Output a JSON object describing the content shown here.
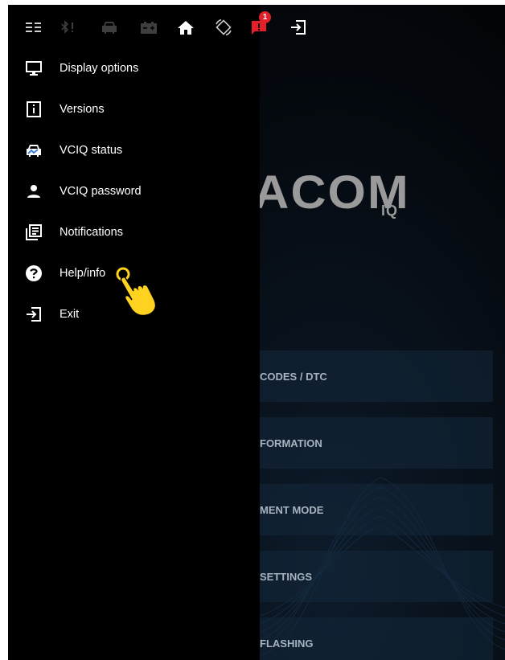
{
  "topbar": {
    "icons": [
      "menu-icon",
      "bluetooth-icon",
      "car-icon",
      "battery-icon",
      "home-icon",
      "rotate-icon",
      "notification-icon",
      "exit-icon"
    ],
    "notification_count": "1"
  },
  "drawer": {
    "items": [
      {
        "label": "Display options",
        "icon": "monitor-icon"
      },
      {
        "label": "Versions",
        "icon": "info-icon"
      },
      {
        "label": "VCIQ status",
        "icon": "car-status-icon"
      },
      {
        "label": "VCIQ password",
        "icon": "person-icon"
      },
      {
        "label": "Notifications",
        "icon": "notifications-list-icon"
      },
      {
        "label": "Help/info",
        "icon": "help-icon"
      },
      {
        "label": "Exit",
        "icon": "exit-icon"
      }
    ]
  },
  "background": {
    "logo_text": "ACOM",
    "logo_sub": "IQ",
    "menu": [
      "CODES / DTC",
      "FORMATION",
      "MENT MODE",
      "SETTINGS",
      "FLASHING"
    ]
  },
  "colors": {
    "accent": "#e2202a",
    "pointer": "#ffd21f",
    "background": "#000000",
    "text": "#ffffff"
  }
}
